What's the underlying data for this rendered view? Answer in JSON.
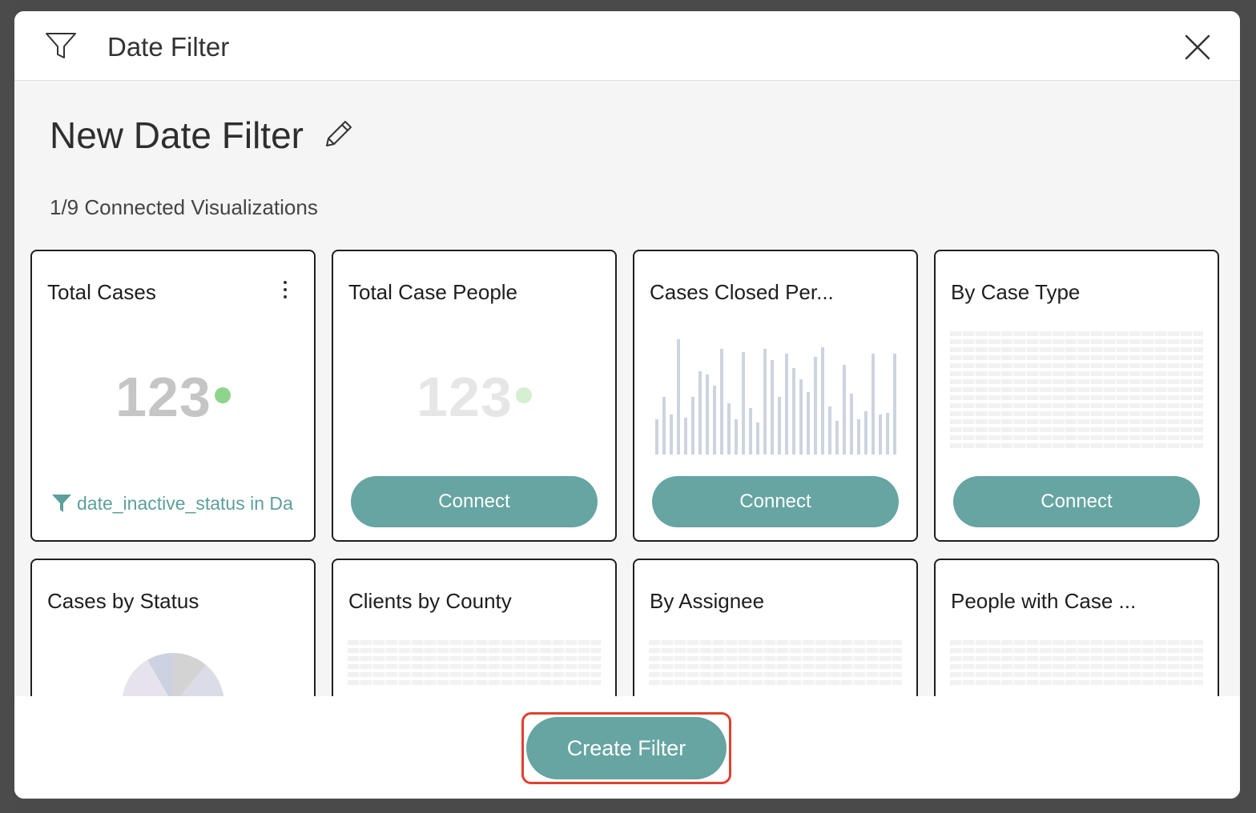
{
  "modal": {
    "title": "Date Filter",
    "filter_name": "New Date Filter",
    "connected_count": "1/9 Connected Visualizations",
    "accent_color": "#66a5a1"
  },
  "cards": [
    {
      "title": "Total Cases",
      "kind": "number",
      "number": "123",
      "connected": true,
      "filter_tag": "date_inactive_status in Da"
    },
    {
      "title": "Total Case People",
      "kind": "number",
      "number": "123",
      "connected": false,
      "button": "Connect"
    },
    {
      "title": "Cases Closed Per...",
      "kind": "bars",
      "connected": false,
      "button": "Connect"
    },
    {
      "title": "By Case Type",
      "kind": "table",
      "connected": false,
      "button": "Connect"
    },
    {
      "title": "Cases by Status",
      "kind": "pie",
      "connected": false
    },
    {
      "title": "Clients by County",
      "kind": "table",
      "connected": false
    },
    {
      "title": "By Assignee",
      "kind": "table",
      "connected": false
    },
    {
      "title": "People with Case ...",
      "kind": "table",
      "connected": false
    }
  ],
  "footer": {
    "create_label": "Create Filter"
  }
}
